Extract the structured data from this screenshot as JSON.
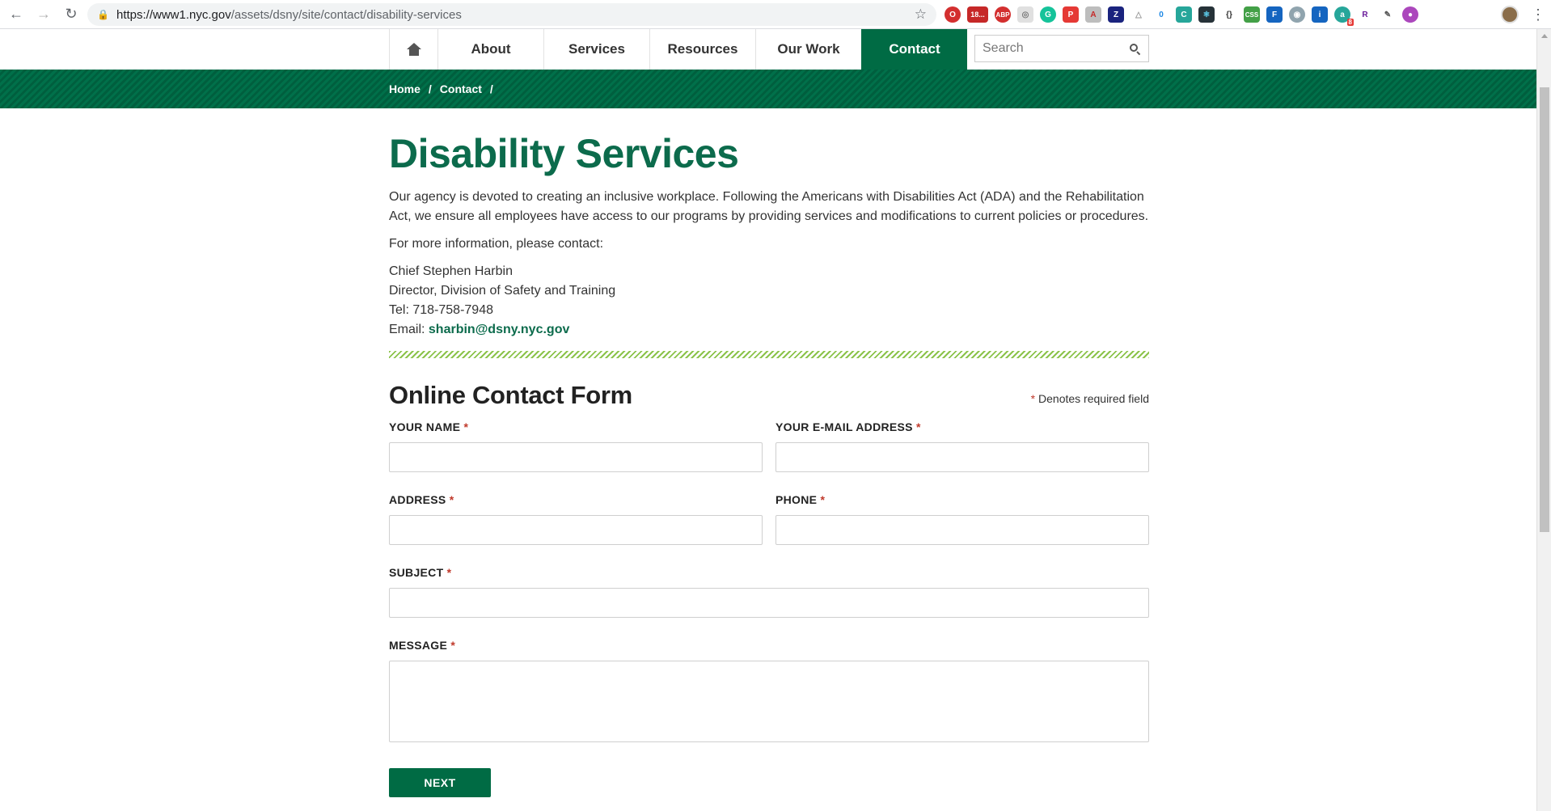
{
  "browser": {
    "url_host": "https://www1.nyc.gov",
    "url_path": "/assets/dsny/site/contact/disability-services",
    "gmail_badge": "18...",
    "ext_badge_count": "8"
  },
  "nav": {
    "items": [
      {
        "label": "About"
      },
      {
        "label": "Services"
      },
      {
        "label": "Resources"
      },
      {
        "label": "Our Work"
      },
      {
        "label": "Contact"
      }
    ],
    "search_placeholder": "Search"
  },
  "breadcrumb": {
    "home": "Home",
    "contact": "Contact",
    "sep": "/"
  },
  "page": {
    "title": "Disability Services",
    "intro": "Our agency is devoted to creating an inclusive workplace. Following the Americans with Disabilities Act (ADA) and the Rehabilitation Act, we ensure all employees have access to our programs by providing services and modifications to current policies or procedures.",
    "more_info": "For more information, please contact:",
    "contact_name": "Chief Stephen Harbin",
    "contact_role": "Director, Division of Safety and Training",
    "contact_tel": "Tel: 718-758-7948",
    "email_label": "Email: ",
    "email": "sharbin@dsny.nyc.gov"
  },
  "form": {
    "title": "Online Contact Form",
    "required_note": "Denotes required field",
    "required_mark": "*",
    "name_label": "YOUR NAME",
    "email_label": "YOUR E-MAIL ADDRESS",
    "address_label": "ADDRESS",
    "phone_label": "PHONE",
    "subject_label": "SUBJECT",
    "message_label": "MESSAGE",
    "next_label": "NEXT"
  },
  "colors": {
    "brand_green": "#006b44",
    "title_green": "#0c6b4c",
    "required_red": "#c0392b"
  }
}
